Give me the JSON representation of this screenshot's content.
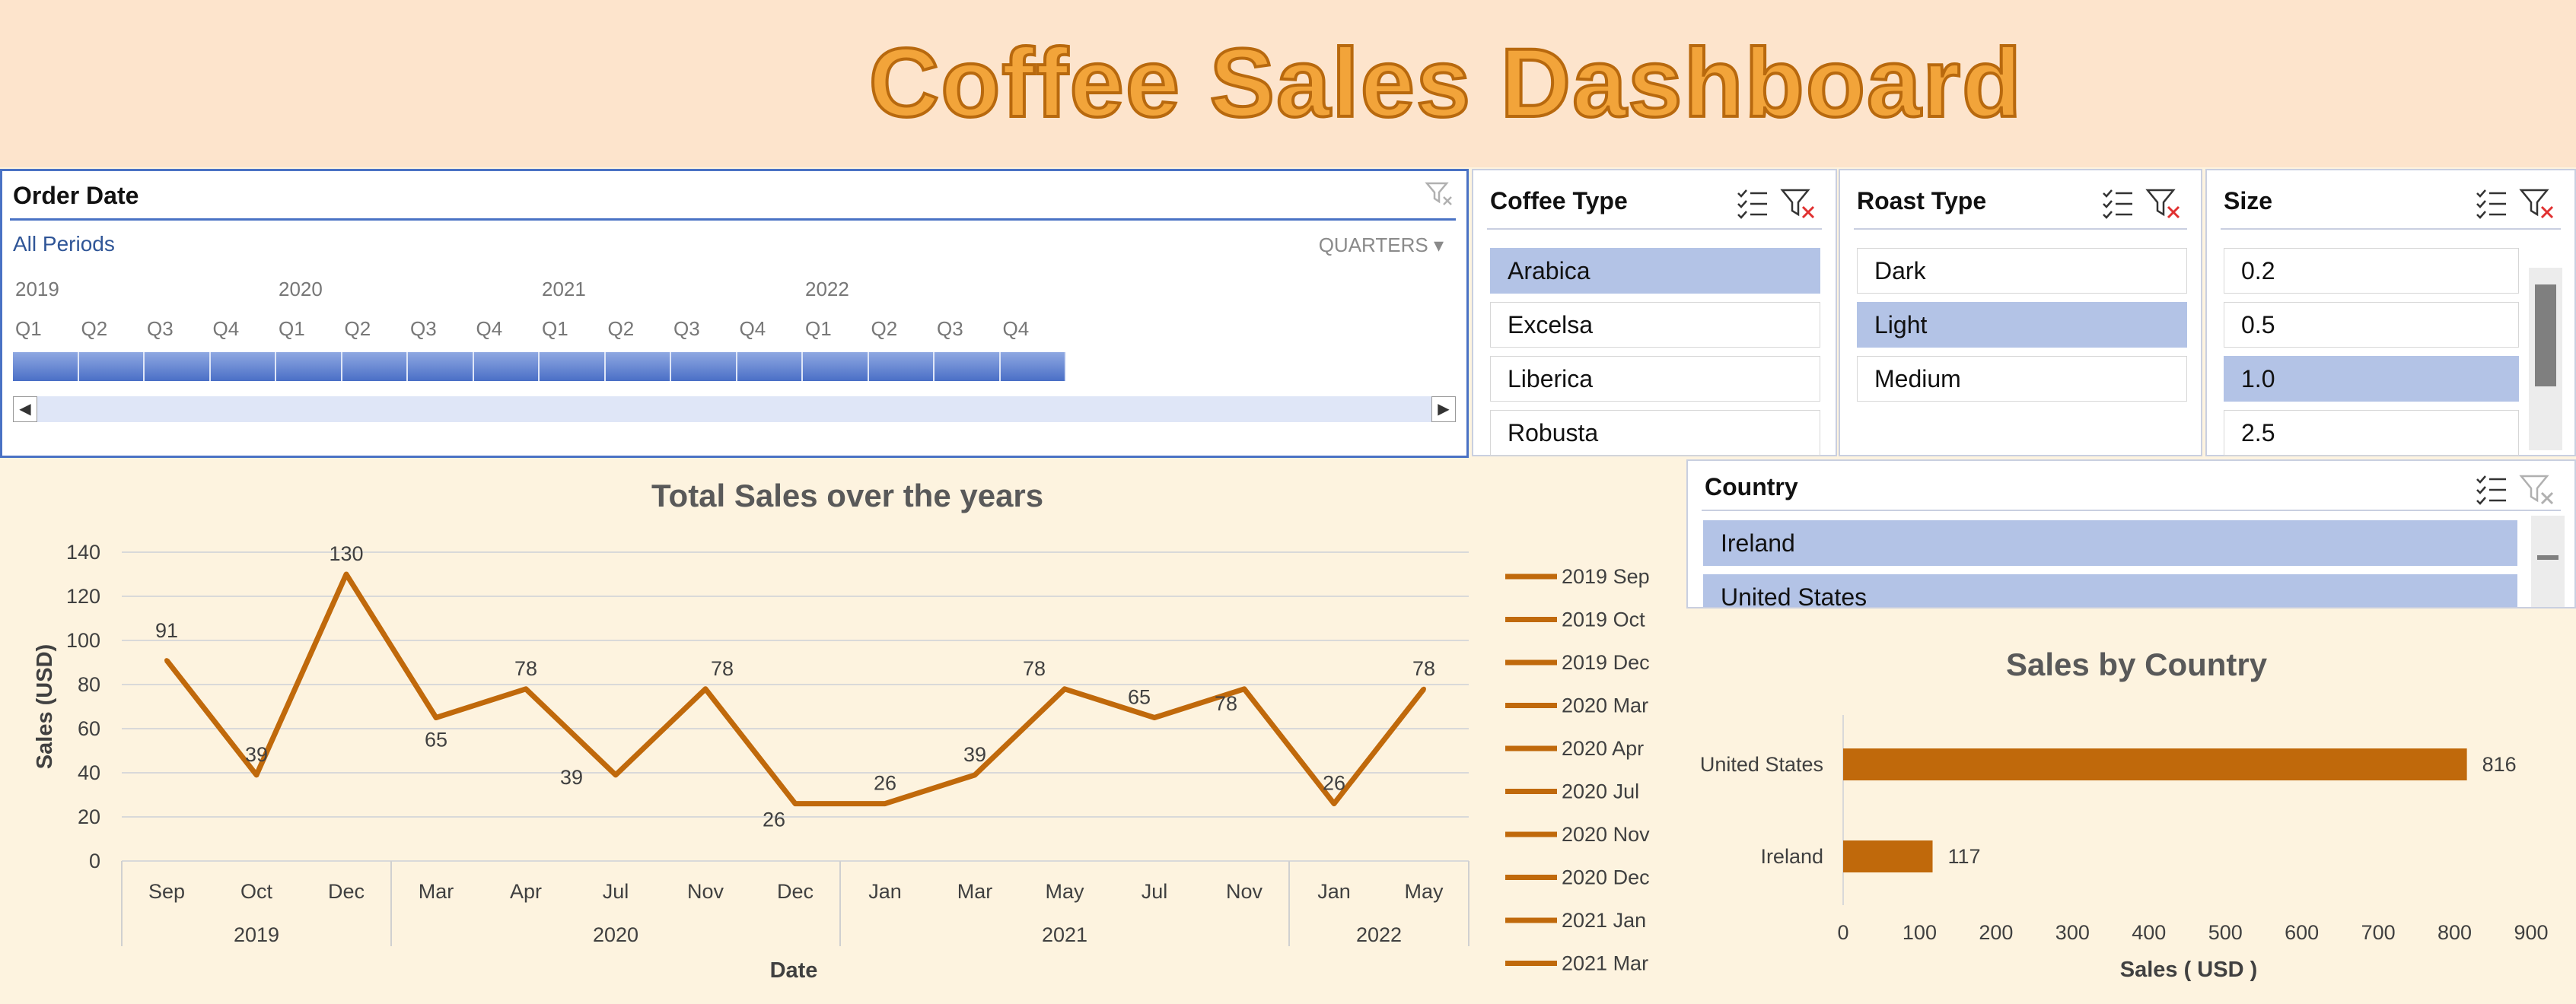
{
  "title": "Coffee Sales Dashboard",
  "order_date": {
    "title": "Order Date",
    "all_periods": "All Periods",
    "level": "QUARTERS",
    "years": [
      "2019",
      "2020",
      "2021",
      "2022"
    ],
    "quarters": [
      "Q1",
      "Q2",
      "Q3",
      "Q4",
      "Q1",
      "Q2",
      "Q3",
      "Q4",
      "Q1",
      "Q2",
      "Q3",
      "Q4",
      "Q1",
      "Q2",
      "Q3",
      "Q4"
    ],
    "selected_range": "2019 Q1 - 2022 Q4"
  },
  "coffee_type": {
    "title": "Coffee Type",
    "items": [
      "Arabica",
      "Excelsa",
      "Liberica",
      "Robusta"
    ],
    "selected": [
      "Arabica"
    ]
  },
  "roast_type": {
    "title": "Roast Type",
    "items": [
      "Dark",
      "Light",
      "Medium"
    ],
    "selected": [
      "Light"
    ]
  },
  "size": {
    "title": "Size",
    "items": [
      "0.2",
      "0.5",
      "1.0",
      "2.5"
    ],
    "selected": [
      "1.0"
    ]
  },
  "country": {
    "title": "Country",
    "items": [
      "Ireland",
      "United States"
    ],
    "selected": [
      "Ireland",
      "United States"
    ]
  },
  "colors": {
    "accent": "#c0690b",
    "slicer_selected": "#b3c3e6",
    "timeline": "#4a6fc6",
    "header_bg": "#fde4cc",
    "body_bg": "#fdf3df"
  },
  "icons": [
    "multi-select-icon",
    "clear-filter-icon"
  ],
  "chart_data": [
    {
      "type": "line",
      "title": "Total Sales over the years",
      "xlabel": "Date",
      "ylabel": "Sales (USD)",
      "ylim": [
        0,
        140
      ],
      "yticks": [
        0,
        20,
        40,
        60,
        80,
        100,
        120,
        140
      ],
      "categories": [
        "Sep",
        "Oct",
        "Dec",
        "Mar",
        "Apr",
        "Jul",
        "Nov",
        "Dec",
        "Jan",
        "Mar",
        "May",
        "Jul",
        "Nov",
        "Jan",
        "May"
      ],
      "years": [
        {
          "label": "2019",
          "span": 3
        },
        {
          "label": "2020",
          "span": 5
        },
        {
          "label": "2021",
          "span": 5
        },
        {
          "label": "2022",
          "span": 2
        }
      ],
      "values": [
        91,
        39,
        130,
        65,
        78,
        39,
        78,
        26,
        26,
        39,
        78,
        65,
        78,
        26,
        78
      ],
      "legend": [
        "2019 Sep",
        "2019 Oct",
        "2019 Dec",
        "2020 Mar",
        "2020 Apr",
        "2020 Jul",
        "2020 Nov",
        "2020 Dec",
        "2021 Jan",
        "2021 Mar"
      ],
      "grid": true
    },
    {
      "type": "bar",
      "orientation": "horizontal",
      "title": "Sales by Country",
      "categories": [
        "United States",
        "Ireland"
      ],
      "values": [
        816,
        117
      ],
      "xlabel": "Sales ( USD )",
      "xlim": [
        0,
        900
      ],
      "xticks": [
        0,
        100,
        200,
        300,
        400,
        500,
        600,
        700,
        800,
        900
      ]
    }
  ]
}
